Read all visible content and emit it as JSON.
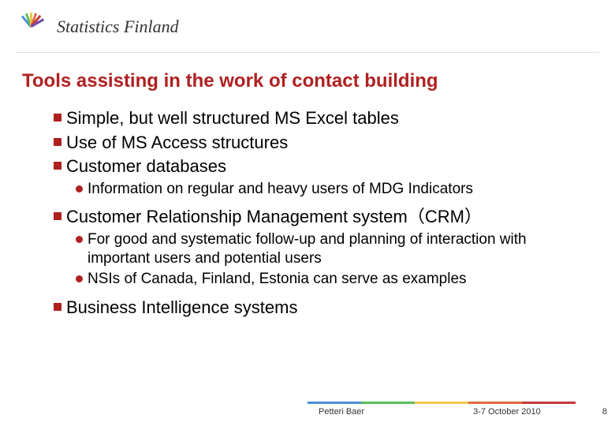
{
  "header": {
    "org_name": "Statistics Finland"
  },
  "title": "Tools assisting in the work of contact building",
  "bullets": {
    "b1": "Simple, but well structured MS Excel tables",
    "b2": "Use of MS Access structures",
    "b3": "Customer databases",
    "b3_sub1": "Information on regular and heavy users of MDG Indicators",
    "b4": "Customer Relationship Management system（CRM）",
    "b4_sub1": "For good and systematic follow-up and planning of interaction with important users and potential users",
    "b4_sub2": "NSIs of Canada, Finland, Estonia can serve as examples",
    "b5": "Business Intelligence systems"
  },
  "footer": {
    "author": "Petteri Baer",
    "date": "3-7 October 2010",
    "page": "8"
  }
}
